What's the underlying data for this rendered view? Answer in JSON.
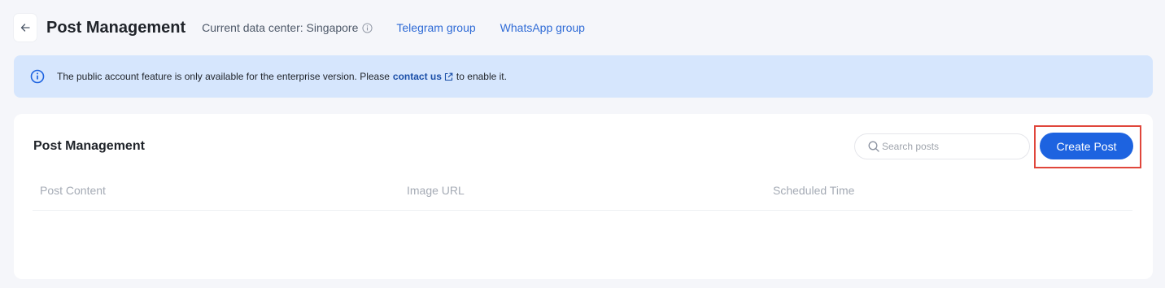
{
  "header": {
    "title": "Post Management",
    "data_center": "Current data center: Singapore",
    "links": {
      "telegram": "Telegram group",
      "whatsapp": "WhatsApp group"
    }
  },
  "alert": {
    "text_before": "The public account feature is only available for the enterprise version. Please",
    "link": "contact us",
    "text_after": "to enable it."
  },
  "card": {
    "title": "Post Management",
    "search": {
      "placeholder": "Search posts",
      "value": ""
    },
    "create_button": "Create Post",
    "table": {
      "columns": [
        "Post Content",
        "Image URL",
        "Scheduled Time"
      ],
      "rows": []
    }
  },
  "colors": {
    "accent": "#1d63e0",
    "link": "#2f6bd6",
    "alert_bg": "#d6e6fd",
    "highlight": "#e0463b"
  },
  "icons": [
    "back-arrow-icon",
    "info-icon",
    "external-link-icon",
    "search-icon"
  ]
}
